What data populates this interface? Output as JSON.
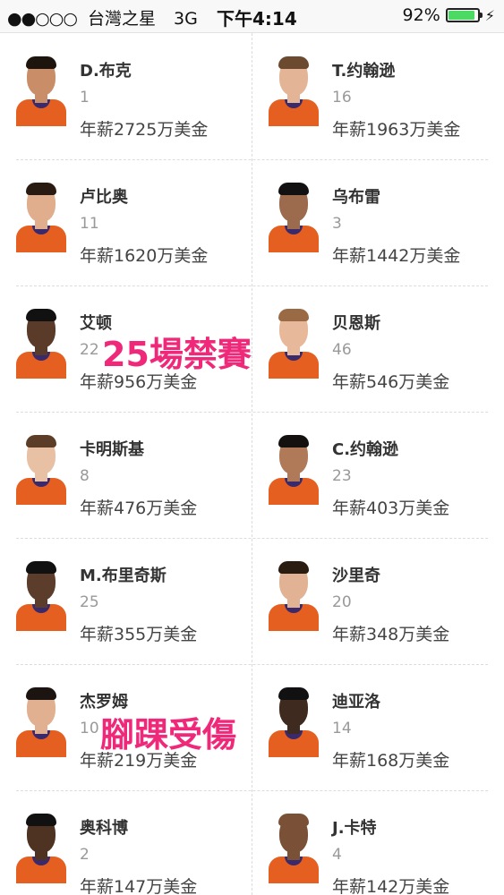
{
  "status_bar": {
    "carrier": "台灣之星",
    "network": "3G",
    "time": "下午4:14",
    "battery": "92%",
    "battery_level": 0.92
  },
  "players": [
    {
      "name": "D.布克",
      "number": "1",
      "salary": "年薪2725万美金",
      "skin": "#c98e68",
      "hair": "#1e140e"
    },
    {
      "name": "T.约翰逊",
      "number": "16",
      "salary": "年薪1963万美金",
      "skin": "#e3b496",
      "hair": "#6b4a30"
    },
    {
      "name": "卢比奥",
      "number": "11",
      "salary": "年薪1620万美金",
      "skin": "#e0ae8c",
      "hair": "#2a1b12"
    },
    {
      "name": "乌布雷",
      "number": "3",
      "salary": "年薪1442万美金",
      "skin": "#9c6a4c",
      "hair": "#111111"
    },
    {
      "name": "艾顿",
      "number": "22",
      "salary": "年薪956万美金",
      "skin": "#5a3a28",
      "hair": "#111111"
    },
    {
      "name": "贝恩斯",
      "number": "46",
      "salary": "年薪546万美金",
      "skin": "#e7b89a",
      "hair": "#9a6a44"
    },
    {
      "name": "卡明斯基",
      "number": "8",
      "salary": "年薪476万美金",
      "skin": "#e8c0a4",
      "hair": "#5c3e28"
    },
    {
      "name": "C.约翰逊",
      "number": "23",
      "salary": "年薪403万美金",
      "skin": "#b07a58",
      "hair": "#151010"
    },
    {
      "name": "M.布里奇斯",
      "number": "25",
      "salary": "年薪355万美金",
      "skin": "#5c3c2a",
      "hair": "#111111"
    },
    {
      "name": "沙里奇",
      "number": "20",
      "salary": "年薪348万美金",
      "skin": "#e2b294",
      "hair": "#2b1c12"
    },
    {
      "name": "杰罗姆",
      "number": "10",
      "salary": "年薪219万美金",
      "skin": "#e0b090",
      "hair": "#1c1410"
    },
    {
      "name": "迪亚洛",
      "number": "14",
      "salary": "年薪168万美金",
      "skin": "#3e2a1e",
      "hair": "#111111"
    },
    {
      "name": "奥科博",
      "number": "2",
      "salary": "年薪147万美金",
      "skin": "#4e3222",
      "hair": "#111111"
    },
    {
      "name": "J.卡特",
      "number": "4",
      "salary": "年薪142万美金",
      "skin": "#7a5036",
      "hair": "#7a5036"
    }
  ],
  "annotations": {
    "ayton": "25場禁賽",
    "jerome": "腳踝受傷"
  },
  "colors": {
    "jersey": "#e56020",
    "jersey_trim": "#3b2a6b",
    "annotation": "#f0287a",
    "battery_fill": "#4cd964"
  }
}
